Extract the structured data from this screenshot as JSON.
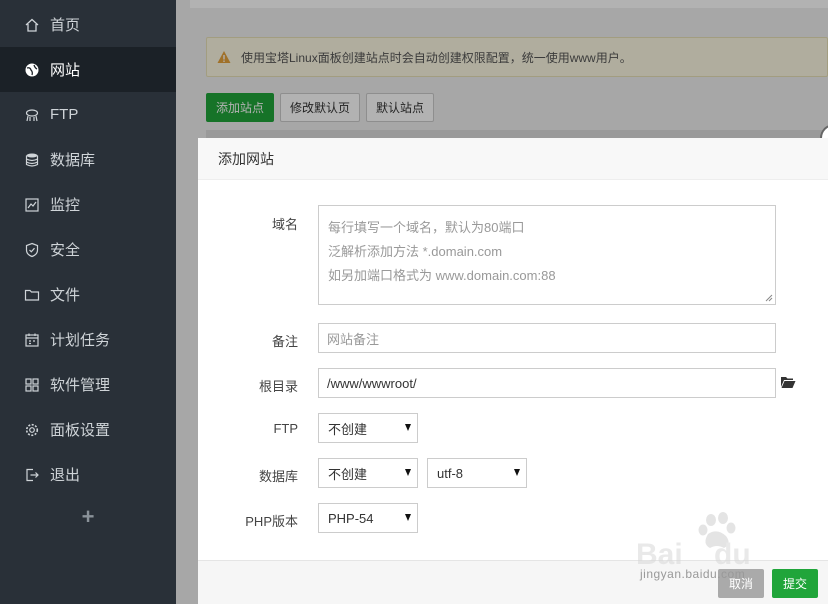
{
  "sidebar": {
    "items": [
      {
        "label": "首页",
        "icon": "home-icon"
      },
      {
        "label": "网站",
        "icon": "globe-icon",
        "active": true
      },
      {
        "label": "FTP",
        "icon": "ftp-icon"
      },
      {
        "label": "数据库",
        "icon": "database-icon"
      },
      {
        "label": "监控",
        "icon": "monitor-icon"
      },
      {
        "label": "安全",
        "icon": "shield-icon"
      },
      {
        "label": "文件",
        "icon": "folder-icon"
      },
      {
        "label": "计划任务",
        "icon": "calendar-icon"
      },
      {
        "label": "软件管理",
        "icon": "apps-icon"
      },
      {
        "label": "面板设置",
        "icon": "gear-icon"
      },
      {
        "label": "退出",
        "icon": "logout-icon"
      }
    ],
    "add_label": "+"
  },
  "main": {
    "alert_text": "使用宝塔Linux面板创建站点时会自动创建权限配置，统一使用www用户。",
    "buttons": {
      "add_site": "添加站点",
      "edit_default": "修改默认页",
      "default_site": "默认站点"
    }
  },
  "modal": {
    "title": "添加网站",
    "domain": {
      "label": "域名",
      "placeholder_lines": [
        "每行填写一个域名，默认为80端口",
        "泛解析添加方法 *.domain.com",
        "如另加端口格式为 www.domain.com:88"
      ]
    },
    "remark": {
      "label": "备注",
      "placeholder": "网站备注"
    },
    "root": {
      "label": "根目录",
      "value": "/www/wwwroot/"
    },
    "ftp": {
      "label": "FTP",
      "value": "不创建"
    },
    "database": {
      "label": "数据库",
      "value": "不创建",
      "charset": "utf-8"
    },
    "php": {
      "label": "PHP版本",
      "value": "PHP-54"
    },
    "cancel_label": "取消",
    "submit_label": "提交"
  },
  "watermark": {
    "text": "jingyan.baidu.com"
  },
  "colors": {
    "accent": "#20a53a",
    "sidebar_bg": "#293038",
    "sidebar_active": "#1b2127"
  }
}
